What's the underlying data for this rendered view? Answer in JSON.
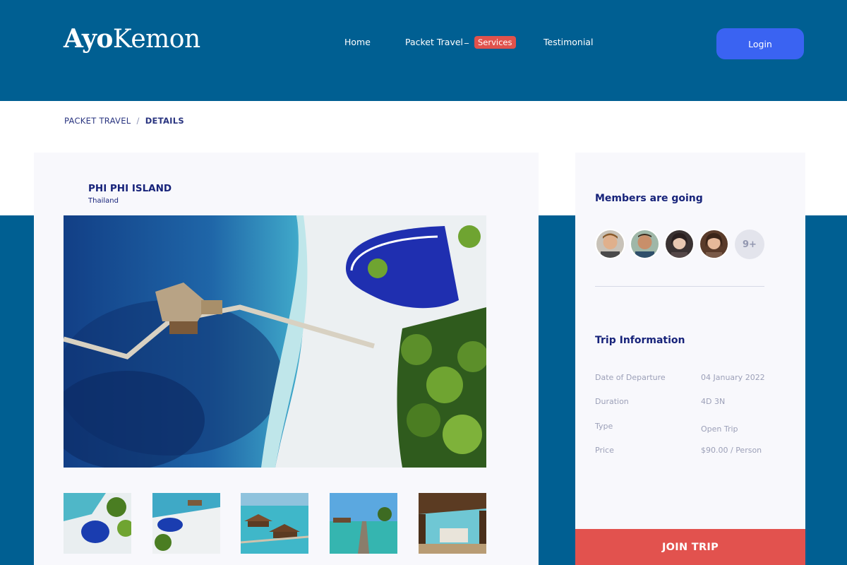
{
  "header": {
    "logo_bold": "Ayo",
    "logo_rest": "Kemon",
    "nav": {
      "home": "Home",
      "packet_travel": "Packet Travel",
      "separator": "_",
      "services": "Services",
      "testimonial": "Testimonial"
    },
    "login_label": "Login"
  },
  "breadcrumb": {
    "parent": "PACKET TRAVEL",
    "separator": "/",
    "current": "DETAILS"
  },
  "destination": {
    "title": "PHI PHI ISLAND",
    "country": "Thailand",
    "thumbnails": [
      "resort-pool-beach",
      "beach-pool-aerial",
      "overwater-villas",
      "jetty-pier",
      "lounge-view"
    ]
  },
  "members": {
    "heading": "Members are going",
    "avatars": [
      "avatar-1",
      "avatar-2",
      "avatar-3",
      "avatar-4"
    ],
    "more_count": "9+"
  },
  "trip_info": {
    "heading": "Trip Information",
    "rows": [
      {
        "label": "Date of Departure",
        "value": "04 January 2022"
      },
      {
        "label": "Duration",
        "value": "4D 3N"
      },
      {
        "label": "Type",
        "value": "Open Trip"
      },
      {
        "label": "Price",
        "value": "$90.00 / Person"
      }
    ]
  },
  "join_label": "JOIN TRIP",
  "colors": {
    "header_bg": "#005f92",
    "accent_blue": "#3a63f2",
    "accent_red": "#e2524e",
    "heading_navy": "#17237a"
  }
}
